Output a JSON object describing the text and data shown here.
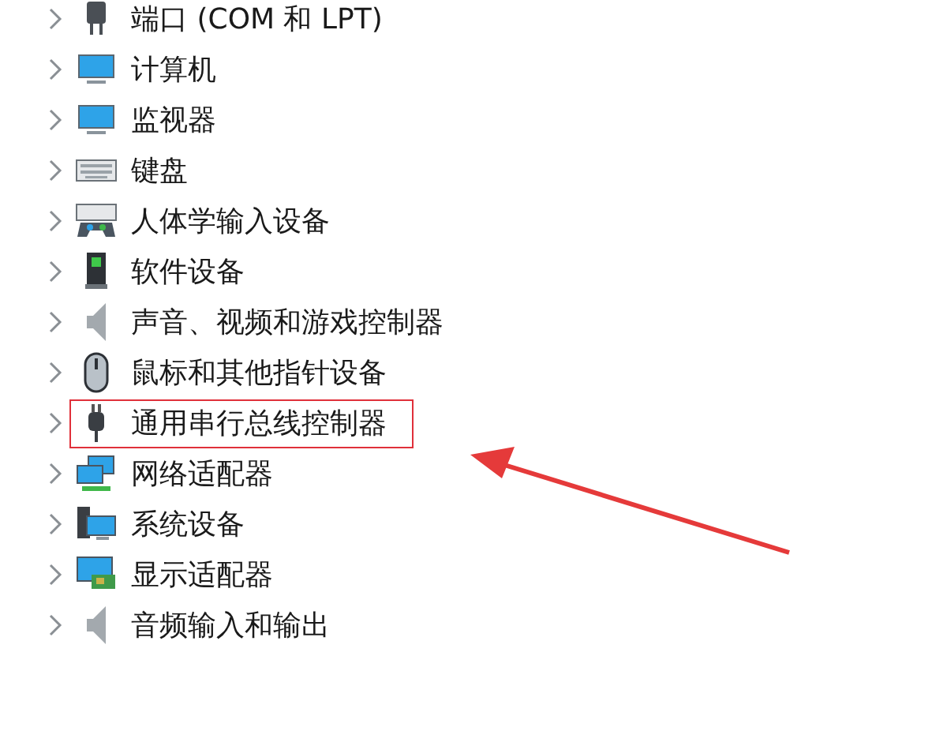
{
  "tree": {
    "items": [
      {
        "label": "端口 (COM 和 LPT)",
        "expanded": false,
        "highlighted": false
      },
      {
        "label": "计算机",
        "expanded": false,
        "highlighted": false
      },
      {
        "label": "监视器",
        "expanded": false,
        "highlighted": false
      },
      {
        "label": "键盘",
        "expanded": false,
        "highlighted": false
      },
      {
        "label": "人体学输入设备",
        "expanded": false,
        "highlighted": false
      },
      {
        "label": "软件设备",
        "expanded": false,
        "highlighted": false
      },
      {
        "label": "声音、视频和游戏控制器",
        "expanded": false,
        "highlighted": false
      },
      {
        "label": "鼠标和其他指针设备",
        "expanded": false,
        "highlighted": false
      },
      {
        "label": "通用串行总线控制器",
        "expanded": false,
        "highlighted": true
      },
      {
        "label": "网络适配器",
        "expanded": false,
        "highlighted": false
      },
      {
        "label": "系统设备",
        "expanded": false,
        "highlighted": false
      },
      {
        "label": "显示适配器",
        "expanded": false,
        "highlighted": false
      },
      {
        "label": "音频输入和输出",
        "expanded": false,
        "highlighted": false
      }
    ]
  }
}
